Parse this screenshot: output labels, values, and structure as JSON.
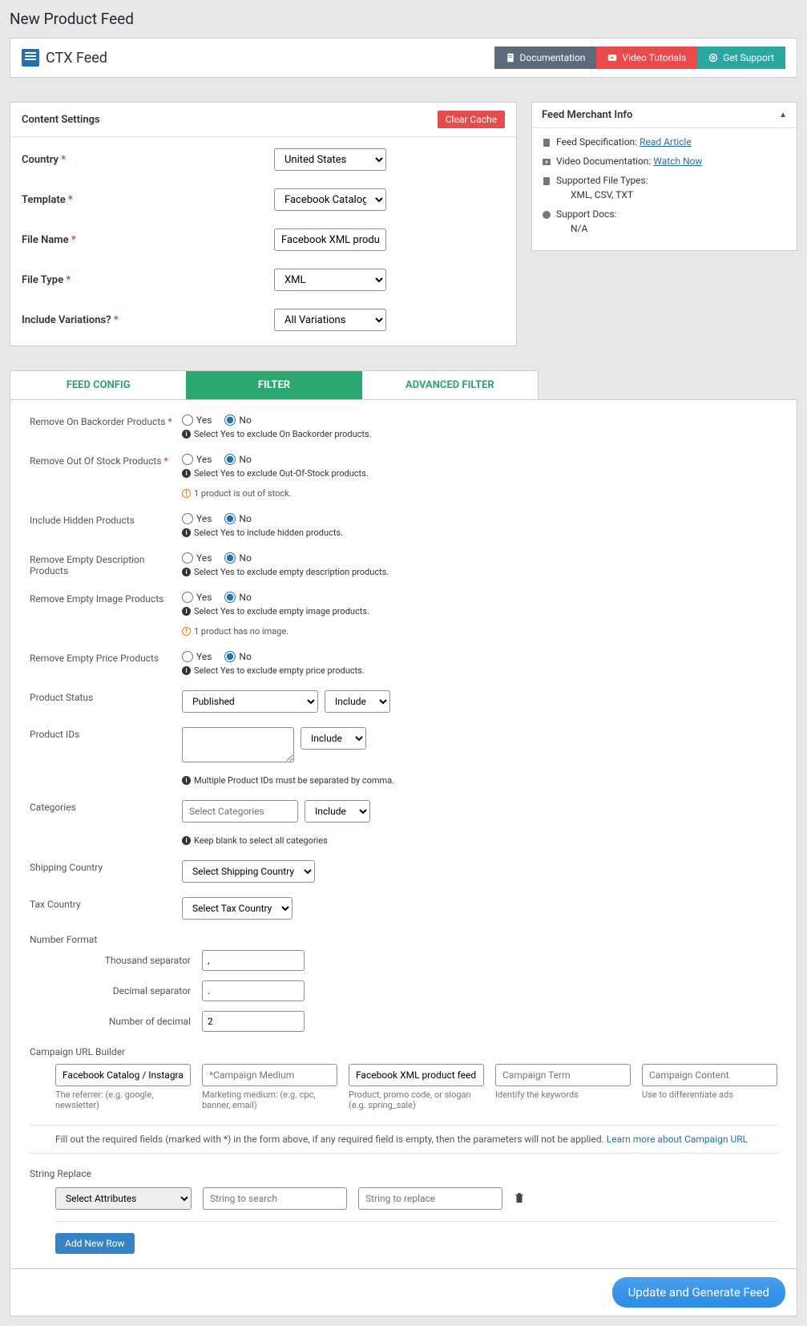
{
  "page_title": "New Product Feed",
  "logo_text": "CTX Feed",
  "top_buttons": {
    "doc": "Documentation",
    "vid": "Video Tutorials",
    "sup": "Get Support"
  },
  "content_settings": {
    "title": "Content Settings",
    "clear_cache": "Clear Cache",
    "country_label": "Country",
    "country_value": "United States",
    "template_label": "Template",
    "template_value": "Facebook Catalog / Instagram",
    "filename_label": "File Name",
    "filename_value": "Facebook XML product feed",
    "filetype_label": "File Type",
    "filetype_value": "XML",
    "variations_label": "Include Variations?",
    "variations_value": "All Variations"
  },
  "tabs": {
    "config": "FEED CONFIG",
    "filter": "FILTER",
    "advanced": "ADVANCED FILTER"
  },
  "filters": {
    "backorder_label": "Remove On Backorder Products",
    "backorder_help": "Select Yes to exclude On Backorder products.",
    "outofstock_label": "Remove Out Of Stock Products",
    "outofstock_help": "Select Yes to exclude Out-Of-Stock products.",
    "outofstock_warn": "1 product is out of stock.",
    "hidden_label": "Include Hidden Products",
    "hidden_help": "Select Yes to include hidden products.",
    "emptydesc_label": "Remove Empty Description Products",
    "emptydesc_help": "Select Yes to exclude empty description products.",
    "emptyimg_label": "Remove Empty Image Products",
    "emptyimg_help": "Select Yes to exclude empty image products.",
    "emptyimg_warn": "1 product has no image.",
    "emptyprice_label": "Remove Empty Price Products",
    "emptyprice_help": "Select Yes to exclude empty price products.",
    "yes": "Yes",
    "no": "No",
    "status_label": "Product Status",
    "status_value": "Published",
    "include": "Include",
    "ids_label": "Product IDs",
    "ids_help": "Multiple Product IDs must be separated by comma.",
    "cat_label": "Categories",
    "cat_placeholder": "Select Categories",
    "cat_help": "Keep blank to select all categories",
    "ship_label": "Shipping Country",
    "ship_value": "Select Shipping Country",
    "tax_label": "Tax Country",
    "tax_value": "Select Tax Country",
    "numfmt_label": "Number Format",
    "thousand_label": "Thousand separator",
    "thousand_value": ",",
    "decimal_label": "Decimal separator",
    "decimal_value": ".",
    "numdec_label": "Number of decimal",
    "numdec_value": "2"
  },
  "campaign": {
    "title": "Campaign URL Builder",
    "source_value": "Facebook Catalog / Instagram",
    "source_hint": "The referrer: (e.g. google, newsletter)",
    "medium_placeholder": "*Campaign Medium",
    "medium_hint": "Marketing medium: (e.g. cpc, banner, email)",
    "name_value": "Facebook XML product feed",
    "name_hint": "Product, promo code, or slogan (e.g. spring_sale)",
    "term_placeholder": "Campaign Term",
    "term_hint": "Identify the keywords",
    "content_placeholder": "Campaign Content",
    "content_hint": "Use to differentiate ads",
    "note_text": "Fill out the required fields (marked with *) in the form above, if any required field is empty, then the parameters will not be applied. ",
    "note_link": "Learn more about Campaign URL"
  },
  "string_replace": {
    "title": "String Replace",
    "attr_placeholder": "Select Attributes",
    "search_placeholder": "String to search",
    "replace_placeholder": "String to replace",
    "add_row": "Add New Row"
  },
  "generate_btn": "Update and Generate Feed",
  "sidebar": {
    "title": "Feed Merchant Info",
    "spec_label": "Feed Specification:",
    "spec_link": "Read Article",
    "video_label": "Video Documentation:",
    "video_link": "Watch Now",
    "filetypes_label": "Supported File Types:",
    "filetypes_value": "XML, CSV, TXT",
    "support_label": "Support Docs:",
    "support_value": "N/A"
  }
}
